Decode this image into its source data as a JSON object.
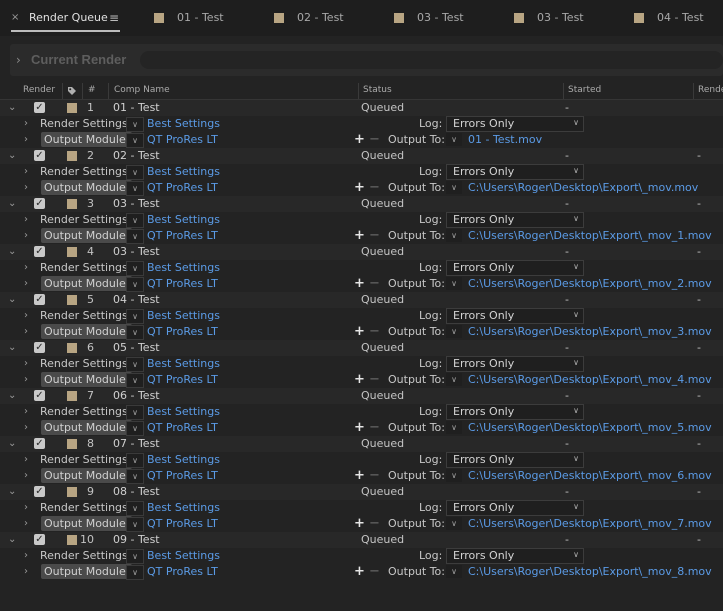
{
  "tabs": {
    "active": {
      "close": "×",
      "label": "Render Queue",
      "menu": "≡"
    },
    "others": [
      "01 - Test",
      "02 - Test",
      "03 - Test",
      "03 - Test",
      "04 - Test"
    ]
  },
  "current_render": {
    "title": "Current Render"
  },
  "columns": {
    "render": "Render",
    "num": "#",
    "comp_name": "Comp Name",
    "status": "Status",
    "started": "Started",
    "render_time": "Rende"
  },
  "labels": {
    "render_settings": "Render Settings:",
    "output_module": "Output Module:",
    "log": "Log:",
    "output_to": "Output To:"
  },
  "items": [
    {
      "num": "1",
      "comp": "01 - Test",
      "status": "Queued",
      "started": "-",
      "render_time": "",
      "render_settings": "Best Settings",
      "output_module": "QT ProRes LT",
      "log": "Errors Only",
      "output_to": "01 - Test.mov"
    },
    {
      "num": "2",
      "comp": "02 - Test",
      "status": "Queued",
      "started": "-",
      "render_time": "-",
      "render_settings": "Best Settings",
      "output_module": "QT ProRes LT",
      "log": "Errors Only",
      "output_to": "C:\\Users\\Roger\\Desktop\\Export\\_mov.mov"
    },
    {
      "num": "3",
      "comp": "03 - Test",
      "status": "Queued",
      "started": "-",
      "render_time": "-",
      "render_settings": "Best Settings",
      "output_module": "QT ProRes LT",
      "log": "Errors Only",
      "output_to": "C:\\Users\\Roger\\Desktop\\Export\\_mov_1.mov"
    },
    {
      "num": "4",
      "comp": "03 - Test",
      "status": "Queued",
      "started": "-",
      "render_time": "-",
      "render_settings": "Best Settings",
      "output_module": "QT ProRes LT",
      "log": "Errors Only",
      "output_to": "C:\\Users\\Roger\\Desktop\\Export\\_mov_2.mov"
    },
    {
      "num": "5",
      "comp": "04 - Test",
      "status": "Queued",
      "started": "-",
      "render_time": "-",
      "render_settings": "Best Settings",
      "output_module": "QT ProRes LT",
      "log": "Errors Only",
      "output_to": "C:\\Users\\Roger\\Desktop\\Export\\_mov_3.mov"
    },
    {
      "num": "6",
      "comp": "05 - Test",
      "status": "Queued",
      "started": "-",
      "render_time": "-",
      "render_settings": "Best Settings",
      "output_module": "QT ProRes LT",
      "log": "Errors Only",
      "output_to": "C:\\Users\\Roger\\Desktop\\Export\\_mov_4.mov"
    },
    {
      "num": "7",
      "comp": "06 - Test",
      "status": "Queued",
      "started": "-",
      "render_time": "-",
      "render_settings": "Best Settings",
      "output_module": "QT ProRes LT",
      "log": "Errors Only",
      "output_to": "C:\\Users\\Roger\\Desktop\\Export\\_mov_5.mov"
    },
    {
      "num": "8",
      "comp": "07 - Test",
      "status": "Queued",
      "started": "-",
      "render_time": "-",
      "render_settings": "Best Settings",
      "output_module": "QT ProRes LT",
      "log": "Errors Only",
      "output_to": "C:\\Users\\Roger\\Desktop\\Export\\_mov_6.mov"
    },
    {
      "num": "9",
      "comp": "08 - Test",
      "status": "Queued",
      "started": "-",
      "render_time": "-",
      "render_settings": "Best Settings",
      "output_module": "QT ProRes LT",
      "log": "Errors Only",
      "output_to": "C:\\Users\\Roger\\Desktop\\Export\\_mov_7.mov"
    },
    {
      "num": "10",
      "comp": "09 - Test",
      "status": "Queued",
      "started": "-",
      "render_time": "-",
      "render_settings": "Best Settings",
      "output_module": "QT ProRes LT",
      "log": "Errors Only",
      "output_to": "C:\\Users\\Roger\\Desktop\\Export\\_mov_8.mov"
    }
  ],
  "icons": {
    "label_swatch": "label-color-swatch",
    "checkbox": "checkmark-icon",
    "tag": "tag-icon"
  },
  "colors": {
    "label_swatch": "#b8a583",
    "link": "#5b9be6",
    "background": "#232323"
  }
}
